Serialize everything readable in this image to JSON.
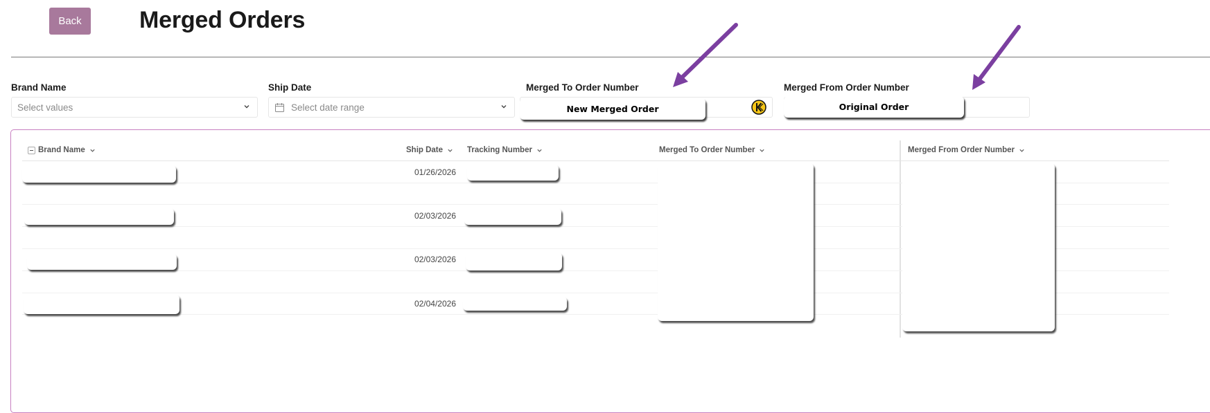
{
  "header": {
    "back_label": "Back",
    "title": "Merged Orders"
  },
  "filters": {
    "brand_name": {
      "label": "Brand Name",
      "placeholder": "Select values"
    },
    "ship_date": {
      "label": "Ship Date",
      "placeholder": "Select date range"
    },
    "merged_to": {
      "label": "Merged To Order Number",
      "callout": "New Merged Order"
    },
    "merged_from": {
      "label": "Merged From Order Number",
      "callout": "Original Order"
    }
  },
  "table": {
    "columns": [
      "Brand Name",
      "Ship Date",
      "Tracking Number",
      "Merged To Order Number",
      "Merged From Order Number"
    ],
    "rows": [
      {
        "ship_date": "01/26/2026"
      },
      {
        "ship_date": "02/03/2026"
      },
      {
        "ship_date": "02/03/2026"
      },
      {
        "ship_date": "02/04/2026"
      }
    ]
  },
  "colors": {
    "back_button": "#a8799c",
    "panel_border": "#c77fc0",
    "annotation_arrow": "#7b3fa0"
  },
  "icons": [
    "calendar-icon",
    "chevron-down-icon",
    "keeper-icon",
    "collapse-icon",
    "arrow-annotation-icon"
  ]
}
